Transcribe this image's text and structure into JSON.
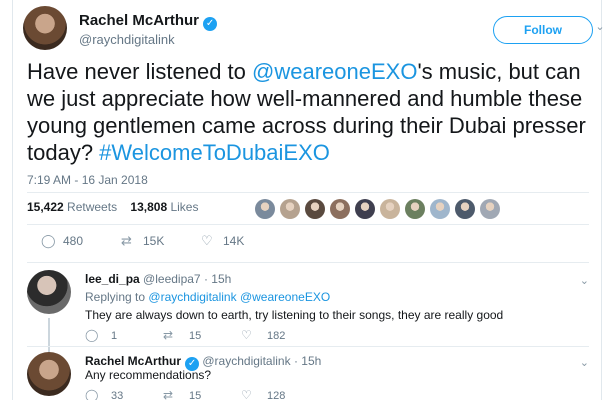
{
  "tweet": {
    "author_name": "Rachel McArthur",
    "author_handle": "@raychdigitalink",
    "follow_label": "Follow",
    "text_parts": {
      "p1": "Have never listened to ",
      "mention": "@weareoneEXO",
      "p2": "'s music, but can we just appreciate how well-mannered and humble these young gentlemen came across during their Dubai presser today? ",
      "hashtag": "#WelcomeToDubaiEXO"
    },
    "timestamp": "7:19 AM - 16 Jan 2018",
    "retweets_count": "15,422",
    "retweets_label": "Retweets",
    "likes_count": "13,808",
    "likes_label": "Likes",
    "liker_colors": [
      "#7a8a9c",
      "#b5a28f",
      "#5a4a3f",
      "#8c6f5e",
      "#3f3f4f",
      "#c9b49c",
      "#6b7f5f",
      "#9fb6cc",
      "#4d5a6b",
      "#a0a8b4"
    ],
    "actions": {
      "replies": "480",
      "retweets": "15K",
      "likes": "14K"
    }
  },
  "replies": [
    {
      "name": "lee_di_pa",
      "handle": "@leedipa7",
      "time": "· 15h",
      "replying_prefix": "Replying to",
      "replying_to": "@raychdigitalink @weareoneEXO",
      "body": "They are always down to earth, try listening to their songs, they are really good",
      "replies": "1",
      "retweets": "15",
      "likes": "182"
    },
    {
      "name": "Rachel McArthur",
      "handle": "@raychdigitalink",
      "time": "· 15h",
      "body": "Any recommendations?",
      "replies": "33",
      "retweets": "15",
      "likes": "128"
    }
  ],
  "icons": {
    "verified": "✓",
    "chevron": "⌄",
    "reply": "◯",
    "retweet": "⇄",
    "like": "♡"
  },
  "colors": {
    "accent": "#1da1f2",
    "link": "#1b95e0",
    "muted": "#657786"
  }
}
